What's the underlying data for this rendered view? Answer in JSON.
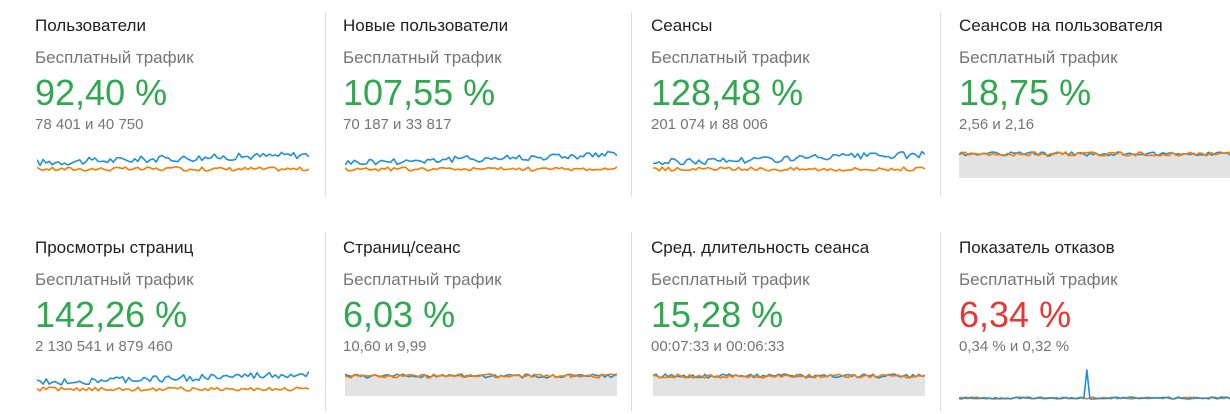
{
  "colors": {
    "positive": "#2fa84f",
    "negative": "#e53935",
    "series_current": "#1e90d6",
    "series_previous": "#f57c00",
    "area_fill": "#e3e3e3"
  },
  "cards": [
    {
      "title": "Пользователи",
      "segment": "Бесплатный трафик",
      "change": "92,40 %",
      "change_status": "positive",
      "comparison": "78 401 и 40 750",
      "sparkline_style": "lines",
      "sparkline_icon": "sparkline-chart"
    },
    {
      "title": "Новые пользователи",
      "segment": "Бесплатный трафик",
      "change": "107,55 %",
      "change_status": "positive",
      "comparison": "70 187 и 33 817",
      "sparkline_style": "lines",
      "sparkline_icon": "sparkline-chart"
    },
    {
      "title": "Сеансы",
      "segment": "Бесплатный трафик",
      "change": "128,48 %",
      "change_status": "positive",
      "comparison": "201 074 и 88 006",
      "sparkline_style": "lines",
      "sparkline_icon": "sparkline-chart"
    },
    {
      "title": "Сеансов на пользователя",
      "segment": "Бесплатный трафик",
      "change": "18,75 %",
      "change_status": "positive",
      "comparison": "2,56 и 2,16",
      "sparkline_style": "area",
      "sparkline_icon": "sparkline-chart"
    },
    {
      "title": "Просмотры страниц",
      "segment": "Бесплатный трафик",
      "change": "142,26 %",
      "change_status": "positive",
      "comparison": "2 130 541 и 879 460",
      "sparkline_style": "lines",
      "sparkline_icon": "sparkline-chart"
    },
    {
      "title": "Страниц/сеанс",
      "segment": "Бесплатный трафик",
      "change": "6,03 %",
      "change_status": "positive",
      "comparison": "10,60 и 9,99",
      "sparkline_style": "area",
      "sparkline_icon": "sparkline-chart"
    },
    {
      "title": "Сред. длительность сеанса",
      "segment": "Бесплатный трафик",
      "change": "15,28 %",
      "change_status": "positive",
      "comparison": "00:07:33 и 00:06:33",
      "sparkline_style": "area",
      "sparkline_icon": "sparkline-chart"
    },
    {
      "title": "Показатель отказов",
      "segment": "Бесплатный трафик",
      "change": "6,34 %",
      "change_status": "negative",
      "comparison": "0,34 % и 0,32 %",
      "sparkline_style": "spike",
      "sparkline_icon": "sparkline-chart"
    }
  ]
}
